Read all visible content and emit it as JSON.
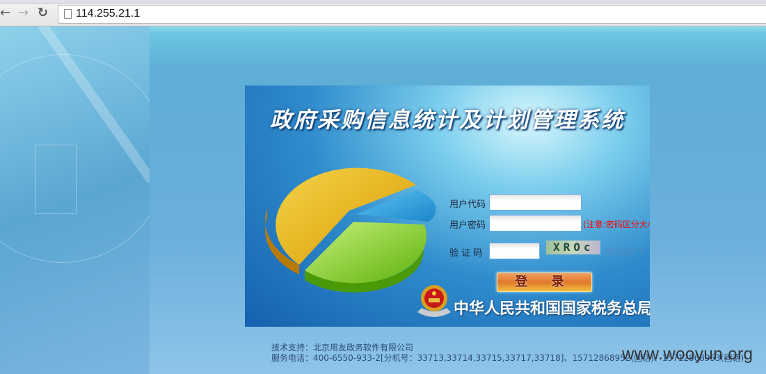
{
  "browser": {
    "url": "114.255.21.1",
    "back": "←",
    "forward": "→",
    "reload": "↻"
  },
  "login": {
    "title": "政府采购信息统计及计划管理系统",
    "user_label": "用户代码",
    "password_label": "用户密码",
    "password_note": "(注意:密码区分大小写)",
    "captcha_label": "验 证 码",
    "captcha_text": "XROc",
    "captcha_refresh": "换张图片?",
    "submit": "登 录",
    "agency": "中华人民共和国国家税务总局"
  },
  "footer": {
    "support": "技术支持：北京用友政务软件有限公司",
    "phone": "服务电话：400-6550-933-2[分机号：33713,33714,33715,33717,33718]、15712868952(固话)、15712868953(固话)"
  },
  "watermark": "www.wooyun.org",
  "colors": {
    "accent": "#1660ae",
    "note": "#ff0000"
  }
}
